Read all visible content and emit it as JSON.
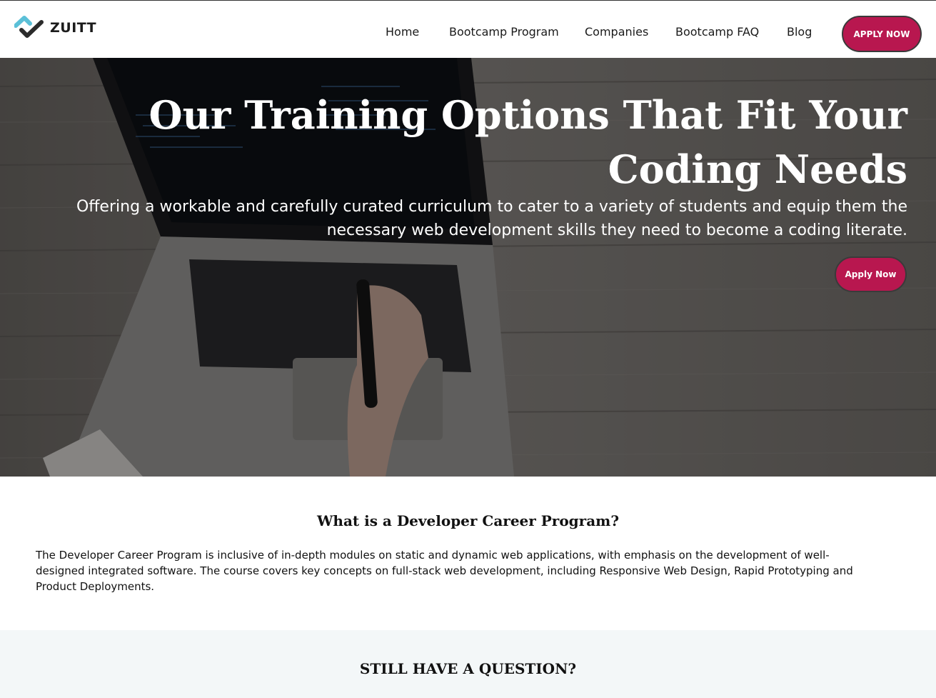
{
  "brand": {
    "name": "ZUITT",
    "colors": {
      "accent": "#b8174f",
      "logo_teal": "#5bc0d8",
      "logo_dark": "#2b2b2b"
    }
  },
  "nav": {
    "items": [
      {
        "label": "Home"
      },
      {
        "label": "Bootcamp Program"
      },
      {
        "label": "Companies"
      },
      {
        "label": "Bootcamp FAQ"
      },
      {
        "label": "Blog"
      }
    ],
    "apply_label": "APPLY NOW"
  },
  "hero": {
    "title": "Our Training Options That Fit Your Coding Needs",
    "subtitle": "Offering a workable and carefully curated curriculum to cater to a variety of students and equip them the necessary web development skills they need to become a coding literate.",
    "apply_label": "Apply Now"
  },
  "about": {
    "heading": "What is a Developer Career Program?",
    "body": "The Developer Career Program is inclusive of in-depth modules on static and dynamic web applications, with emphasis on the development of well-designed integrated software. The course covers key concepts on full-stack web development, including Responsive Web Design, Rapid Prototyping and Product Deployments."
  },
  "question": {
    "heading": "STILL HAVE A QUESTION?"
  }
}
